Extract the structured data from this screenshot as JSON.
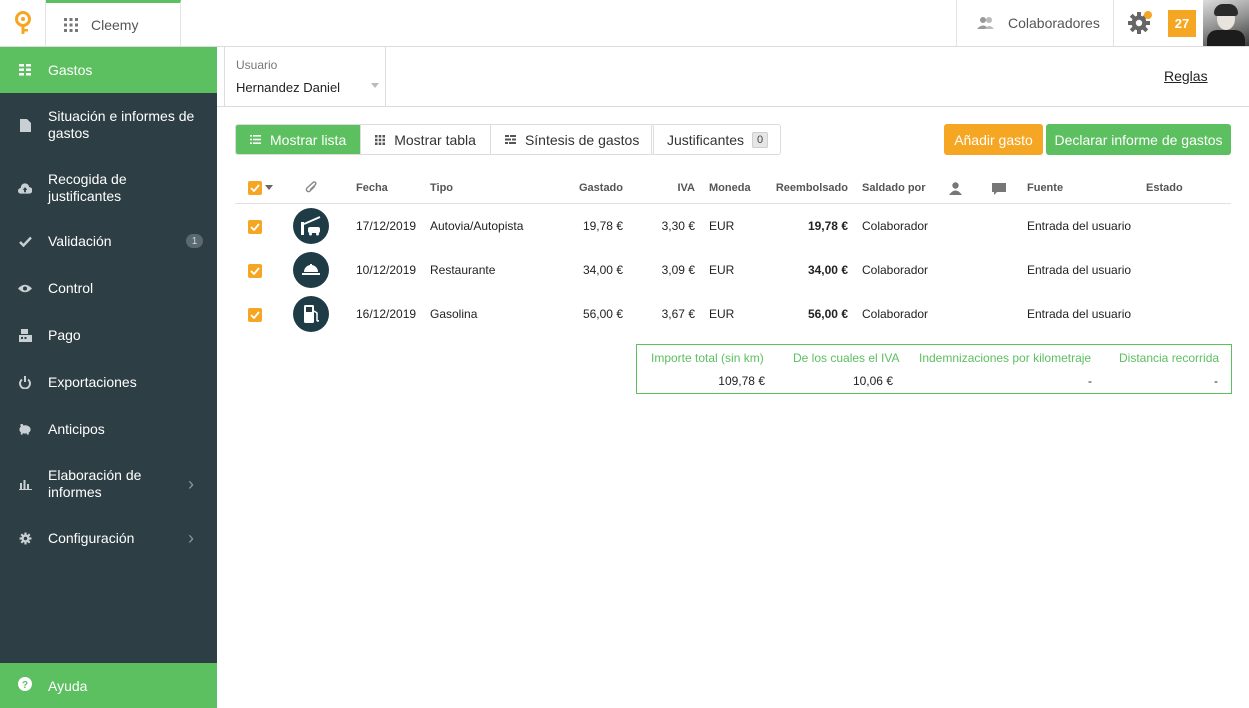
{
  "header": {
    "app_name": "Cleemy",
    "collaborators_label": "Colaboradores",
    "notification_count": "27"
  },
  "colors": {
    "accent_green": "#5cbf60",
    "accent_orange": "#f5a623",
    "sidebar_bg": "#2d3e44"
  },
  "sidebar": {
    "items": [
      {
        "label": "Gastos",
        "icon": "grid-icon",
        "active": true
      },
      {
        "label": "Situación e informes de gastos",
        "icon": "document-icon"
      },
      {
        "label": "Recogida de justificantes",
        "icon": "cloud-upload-icon"
      },
      {
        "label": "Validación",
        "icon": "check-icon",
        "badge": "1"
      },
      {
        "label": "Control",
        "icon": "eye-icon"
      },
      {
        "label": "Pago",
        "icon": "cash-register-icon"
      },
      {
        "label": "Exportaciones",
        "icon": "export-icon"
      },
      {
        "label": "Anticipos",
        "icon": "piggy-bank-icon"
      },
      {
        "label": "Elaboración de informes",
        "icon": "bar-chart-icon",
        "expandable": true
      },
      {
        "label": "Configuración",
        "icon": "gear-icon",
        "expandable": true
      }
    ],
    "help_label": "Ayuda"
  },
  "userbar": {
    "user_label": "Usuario",
    "user_value": "Hernandez Daniel",
    "rules_link": "Reglas"
  },
  "toolbar": {
    "view_list": "Mostrar lista",
    "view_table": "Mostrar tabla",
    "view_summary": "Síntesis de gastos",
    "receipts_label": "Justificantes",
    "receipts_count": "0",
    "add_expense": "Añadir gasto",
    "declare_report": "Declarar informe de gastos"
  },
  "table": {
    "headers": {
      "date": "Fecha",
      "type": "Tipo",
      "spent": "Gastado",
      "vat": "IVA",
      "currency": "Moneda",
      "reimbursed": "Reembolsado",
      "paid_by": "Saldado por",
      "source": "Fuente",
      "status": "Estado"
    },
    "rows": [
      {
        "date": "17/12/2019",
        "type": "Autovia/Autopista",
        "icon": "toll-road-icon",
        "spent": "19,78 €",
        "vat": "3,30 €",
        "currency": "EUR",
        "reimbursed": "19,78 €",
        "paid_by": "Colaborador",
        "source": "Entrada del usuario",
        "status": ""
      },
      {
        "date": "10/12/2019",
        "type": "Restaurante",
        "icon": "restaurant-icon",
        "spent": "34,00 €",
        "vat": "3,09 €",
        "currency": "EUR",
        "reimbursed": "34,00 €",
        "paid_by": "Colaborador",
        "source": "Entrada del usuario",
        "status": ""
      },
      {
        "date": "16/12/2019",
        "type": "Gasolina",
        "icon": "fuel-icon",
        "spent": "56,00 €",
        "vat": "3,67 €",
        "currency": "EUR",
        "reimbursed": "56,00 €",
        "paid_by": "Colaborador",
        "source": "Entrada del usuario",
        "status": ""
      }
    ]
  },
  "totals": {
    "total_label": "Importe total (sin km)",
    "total_value": "109,78 €",
    "vat_label": "De los cuales el IVA",
    "vat_value": "10,06 €",
    "mileage_label": "Indemnizaciones por kilometraje",
    "mileage_value": "-",
    "distance_label": "Distancia recorrida",
    "distance_value": "-"
  }
}
